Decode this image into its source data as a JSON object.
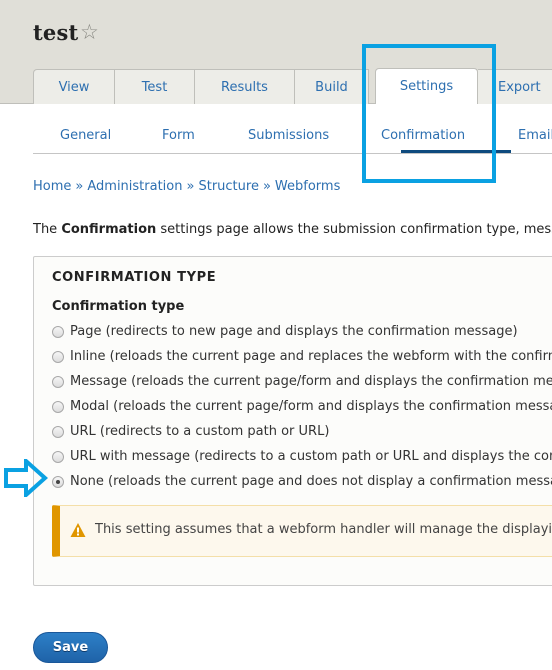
{
  "page": {
    "title": "test",
    "favorite_icon": "star-outline-icon"
  },
  "tabs": [
    {
      "label": "View",
      "active": false
    },
    {
      "label": "Test",
      "active": false
    },
    {
      "label": "Results",
      "active": false
    },
    {
      "label": "Build",
      "active": false
    },
    {
      "label": "Settings",
      "active": true
    },
    {
      "label": "Export",
      "active": false
    }
  ],
  "subtabs": [
    {
      "label": "General",
      "active": false
    },
    {
      "label": "Form",
      "active": false
    },
    {
      "label": "Submissions",
      "active": false
    },
    {
      "label": "Confirmation",
      "active": true
    },
    {
      "label": "Email",
      "active": false
    }
  ],
  "breadcrumb": {
    "items": [
      "Home",
      "Administration",
      "Structure",
      "Webforms"
    ],
    "separator": "»"
  },
  "intro": {
    "prefix": "The ",
    "bold": "Confirmation",
    "suffix": " settings page allows the submission confirmation type, message"
  },
  "confirmation_type": {
    "legend": "CONFIRMATION TYPE",
    "field_label": "Confirmation type",
    "options": [
      {
        "label": "Page (redirects to new page and displays the confirmation message)",
        "checked": false
      },
      {
        "label": "Inline (reloads the current page and replaces the webform with the confirmation message)",
        "checked": false
      },
      {
        "label": "Message (reloads the current page/form and displays the confirmation message)",
        "checked": false
      },
      {
        "label": "Modal (reloads the current page/form and displays the confirmation message in a modal)",
        "checked": false
      },
      {
        "label": "URL (redirects to a custom path or URL)",
        "checked": false
      },
      {
        "label": "URL with message (redirects to a custom path or URL and displays the confirmation message)",
        "checked": false
      },
      {
        "label": "None (reloads the current page and does not display a confirmation message)",
        "checked": true
      }
    ],
    "warning": {
      "icon": "warning-triangle-icon",
      "text": "This setting assumes that a webform handler will manage the displaying of a confirmation message."
    }
  },
  "actions": {
    "save_label": "Save"
  },
  "annotations": {
    "highlight_color": "#0aa1e2",
    "arrow_color": "#0aa1e2"
  }
}
